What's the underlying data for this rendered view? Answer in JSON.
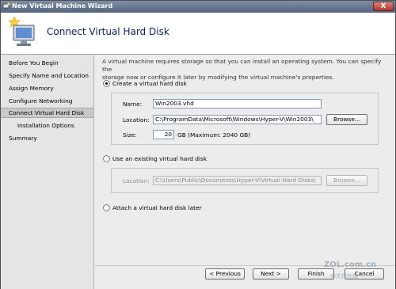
{
  "window": {
    "title": "New Virtual Machine Wizard",
    "close_glyph": "X"
  },
  "header": {
    "title": "Connect Virtual Hard Disk"
  },
  "nav": {
    "items": [
      {
        "label": "Before You Begin"
      },
      {
        "label": "Specify Name and Location"
      },
      {
        "label": "Assign Memory"
      },
      {
        "label": "Configure Networking"
      },
      {
        "label": "Connect Virtual Hard Disk"
      },
      {
        "label": "Installation Options"
      },
      {
        "label": "Summary"
      }
    ]
  },
  "content": {
    "description_line1": "A virtual machine requires storage so that you can install an operating system. You can specify the",
    "description_line2": "storage now or configure it later by modifying the virtual machine's properties.",
    "option_create": "Create a virtual hard disk",
    "create": {
      "name_label": "Name:",
      "name_value": "Win2003.vhd",
      "location_label": "Location:",
      "location_value": "C:\\ProgramData\\Microsoft\\Windows\\Hyper-V\\Win2003\\",
      "browse_label": "Browse...",
      "size_label": "Size:",
      "size_value": "20",
      "size_unit": "GB (Maximum: 2040 GB)"
    },
    "option_existing": "Use an existing virtual hard disk",
    "existing": {
      "location_label": "Location:",
      "location_value": "C:\\Users\\Public\\Documents\\Hyper-V\\Virtual Hard Disks\\",
      "browse_label": "Browse..."
    },
    "option_later": "Attach a virtual hard disk later"
  },
  "footer": {
    "previous_label": "< Previous",
    "next_label": "Next >",
    "finish_label": "Finish",
    "cancel_label": "Cancel"
  },
  "watermark": {
    "line1": "ZOL.com.cn",
    "line2": "中关村在线"
  },
  "colors": {
    "title_text": "#0a246a",
    "nav_active": "#c9c9c9",
    "titlebar": "#55647d"
  }
}
